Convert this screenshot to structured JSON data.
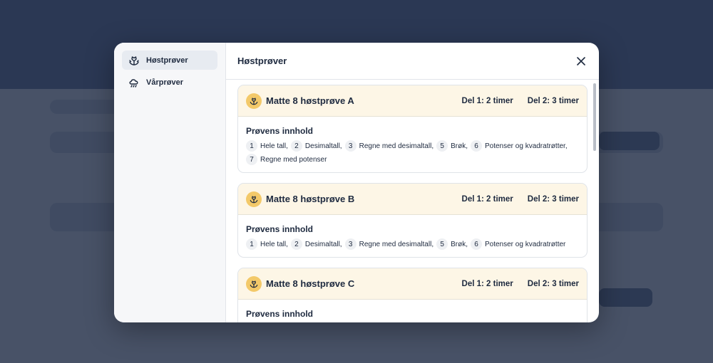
{
  "sidebar": {
    "items": [
      {
        "label": "Høstprøver",
        "icon": "autumn-leaf-icon",
        "active": true
      },
      {
        "label": "Vårprøver",
        "icon": "rain-cloud-icon",
        "active": false
      }
    ]
  },
  "header": {
    "title": "Høstprøver",
    "close_icon": "close-icon"
  },
  "accent": {
    "card_header_bg": "#fdf6e6",
    "badge_bg": "#f3c969"
  },
  "cards": [
    {
      "title": "Matte 8 høstprøve A",
      "del1": "Del 1: 2 timer",
      "del2": "Del 2: 3 timer",
      "content_title": "Prøvens innhold",
      "topics": [
        {
          "num": "1",
          "label": "Hele tall,"
        },
        {
          "num": "2",
          "label": "Desimaltall,"
        },
        {
          "num": "3",
          "label": "Regne med desimaltall,"
        },
        {
          "num": "5",
          "label": "Brøk,"
        },
        {
          "num": "6",
          "label": "Potenser og kvadratrøtter,"
        },
        {
          "num": "7",
          "label": "Regne med potenser"
        }
      ]
    },
    {
      "title": "Matte 8 høstprøve B",
      "del1": "Del 1: 2 timer",
      "del2": "Del 2: 3 timer",
      "content_title": "Prøvens innhold",
      "topics": [
        {
          "num": "1",
          "label": "Hele tall,"
        },
        {
          "num": "2",
          "label": "Desimaltall,"
        },
        {
          "num": "3",
          "label": "Regne med desimaltall,"
        },
        {
          "num": "5",
          "label": "Brøk,"
        },
        {
          "num": "6",
          "label": "Potenser og kvadratrøtter"
        }
      ]
    },
    {
      "title": "Matte 8 høstprøve C",
      "del1": "Del 1: 2 timer",
      "del2": "Del 2: 3 timer",
      "content_title": "Prøvens innhold",
      "topics": []
    }
  ]
}
